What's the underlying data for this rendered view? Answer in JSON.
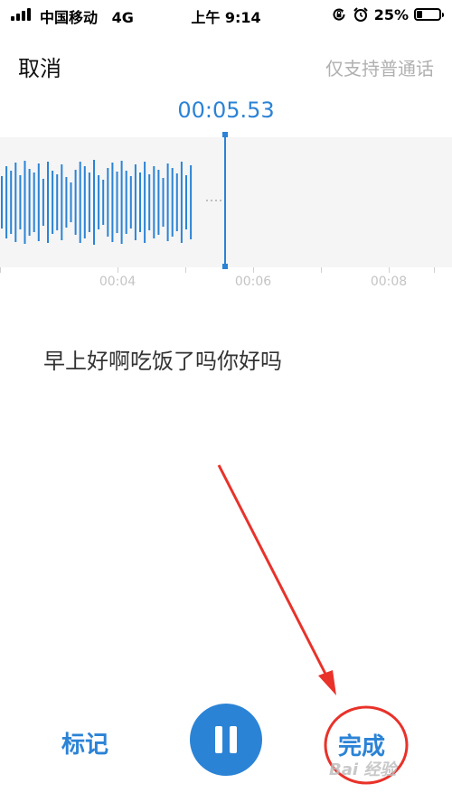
{
  "status_bar": {
    "carrier": "中国移动",
    "network": "4G",
    "time": "上午 9:14",
    "battery_percent": "25%",
    "battery_level": 0.25,
    "icons": [
      "signal-icon",
      "orientation-lock-icon",
      "alarm-icon",
      "battery-icon"
    ]
  },
  "header": {
    "cancel_label": "取消",
    "only_phone_label": "仅支持普通话"
  },
  "recording": {
    "elapsed": "00:05.53",
    "timeline_labels": [
      "00:04",
      "00:06",
      "00:08"
    ],
    "transcript": "早上好啊吃饭了吗你好吗"
  },
  "controls": {
    "mark_label": "标记",
    "pause_icon": "pause-icon",
    "done_label": "完成"
  },
  "annotation": {
    "color": "#e8322a"
  },
  "watermark": {
    "text": "Bai 经验"
  },
  "colors": {
    "accent": "#2b83d6",
    "annotation": "#e8322a"
  }
}
